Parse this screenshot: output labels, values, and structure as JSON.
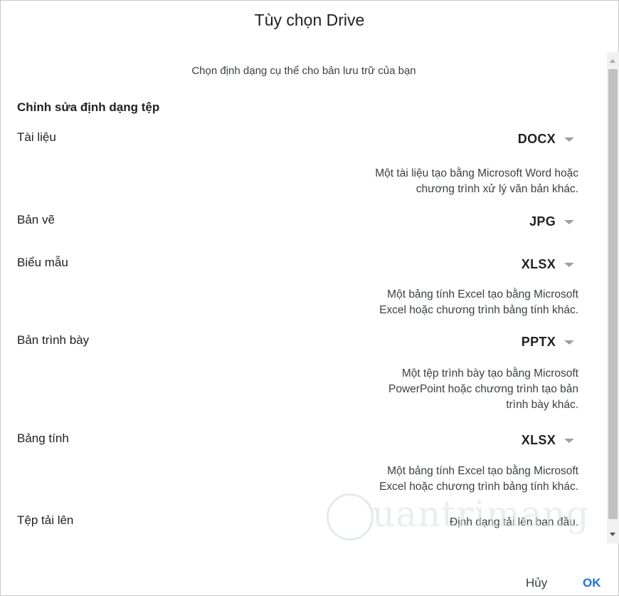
{
  "dialog": {
    "title": "Tùy chọn Drive",
    "subtitle": "Chọn định dạng cụ thể cho bản lưu trữ của bạn",
    "section_heading": "Chỉnh sửa định dạng tệp",
    "rows": [
      {
        "label": "Tài liệu",
        "format": "DOCX",
        "desc_lines": [
          "Một tài liệu tạo bằng Microsoft Word hoặc",
          "chương trình xử lý văn bản khác."
        ]
      },
      {
        "label": "Bản vẽ",
        "format": "JPG"
      },
      {
        "label": "Biểu mẫu",
        "format": "XLSX",
        "desc_lines": [
          "Một bảng tính Excel tạo bằng Microsoft",
          "Excel hoặc chương trình bảng tính khác."
        ]
      },
      {
        "label": "Bản trình bày",
        "format": "PPTX",
        "desc_lines": [
          "Một tệp trình bày tạo bằng Microsoft",
          "PowerPoint hoặc chương trình tạo bản",
          "trình bày khác."
        ]
      },
      {
        "label": "Bảng tính",
        "format": "XLSX",
        "desc_lines": [
          "Một bảng tính Excel tạo bằng Microsoft",
          "Excel hoặc chương trình bảng tính khác."
        ]
      },
      {
        "label": "Tệp tải lên",
        "value_text": "Định dạng tải lên ban đầu."
      }
    ],
    "cancel_label": "Hủy",
    "ok_label": "OK",
    "watermark_text": "uantrimang"
  },
  "colors": {
    "accent": "#1a73e8",
    "text": "#202124",
    "secondary_text": "#3c4043",
    "caret": "#9aa0a6",
    "scrollbar_thumb": "#c1c1c1"
  },
  "icons": [
    "caret-down-icon",
    "scroll-up-arrow-icon",
    "scroll-down-arrow-icon"
  ]
}
